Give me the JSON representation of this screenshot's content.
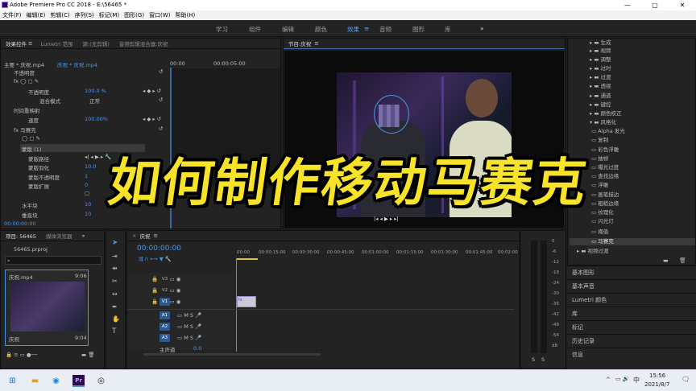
{
  "window": {
    "title": "Adobe Premiere Pro CC 2018 - E:\\56465 *",
    "controls": [
      "—",
      "▢",
      "✕"
    ]
  },
  "menu": [
    "文件(F)",
    "编辑(E)",
    "剪辑(C)",
    "序列(S)",
    "标记(M)",
    "图形(G)",
    "窗口(W)",
    "帮助(H)"
  ],
  "workspaces": {
    "items": [
      "学习",
      "组件",
      "编辑",
      "颜色",
      "效果",
      "音频",
      "图形",
      "库"
    ],
    "active": "效果",
    "menu_glyph": "≡",
    "overflow": "»"
  },
  "effect_controls": {
    "tabs": [
      "效果控件",
      "Lumetri 范围",
      "源:(无剪辑)",
      "音频剪辑混合器:庆祝"
    ],
    "active_tab": "效果控件",
    "tab_menu": "≡",
    "header_left": "主要 * 庆祝.mp4",
    "header_right": "庆祝 * 庆祝.mp4",
    "ruler_start": "00:00",
    "ruler_mid": "00:00:05:00",
    "rows": {
      "opacity_header": "不透明度",
      "opacity": "不透明度",
      "opacity_value": "100.0 %",
      "blend_mode": "混合模式",
      "blend_value": "正常",
      "time_remap": "时间重映射",
      "speed": "速度",
      "speed_value": "100.00%",
      "mosaic": "马赛克",
      "mask": "蒙版 (1)",
      "mask_path": "蒙版路径",
      "mask_feather": "蒙版羽化",
      "mask_feather_value": "10.0",
      "mask_opacity": "蒙版不透明度",
      "mask_opacity_value": "1",
      "mask_expand": "蒙版扩展",
      "mask_expand_value": "0",
      "h_blocks": "水平块",
      "h_blocks_value": "10",
      "v_blocks": "垂直块",
      "v_blocks_value": "10"
    },
    "timecode": "00:00:00:00"
  },
  "program_monitor": {
    "title": "节目:庆祝",
    "menu_glyph": "≡"
  },
  "overlay": {
    "headline": "如何制作移动马赛克"
  },
  "effects_tree": {
    "items": [
      {
        "label": "生成",
        "kind": "folder"
      },
      {
        "label": "视频",
        "kind": "folder"
      },
      {
        "label": "调整",
        "kind": "folder"
      },
      {
        "label": "过时",
        "kind": "folder"
      },
      {
        "label": "过渡",
        "kind": "folder"
      },
      {
        "label": "透视",
        "kind": "folder"
      },
      {
        "label": "通道",
        "kind": "folder"
      },
      {
        "label": "键控",
        "kind": "folder"
      },
      {
        "label": "颜色校正",
        "kind": "folder"
      },
      {
        "label": "风格化",
        "kind": "folder-open"
      },
      {
        "label": "Alpha 发光",
        "kind": "effect"
      },
      {
        "label": "复制",
        "kind": "effect"
      },
      {
        "label": "彩色浮雕",
        "kind": "effect"
      },
      {
        "label": "抽帧",
        "kind": "effect"
      },
      {
        "label": "曝光过度",
        "kind": "effect"
      },
      {
        "label": "查找边缘",
        "kind": "effect"
      },
      {
        "label": "浮雕",
        "kind": "effect"
      },
      {
        "label": "画笔描边",
        "kind": "effect"
      },
      {
        "label": "粗糙边缘",
        "kind": "effect"
      },
      {
        "label": "纹理化",
        "kind": "effect"
      },
      {
        "label": "闪光灯",
        "kind": "effect"
      },
      {
        "label": "阈值",
        "kind": "effect"
      },
      {
        "label": "马赛克",
        "kind": "effect-selected"
      },
      {
        "label": "视频过渡",
        "kind": "folder"
      }
    ]
  },
  "side_panels": [
    "基本图形",
    "基本声音",
    "Lumetri 颜色",
    "库",
    "标记",
    "历史记录",
    "信息"
  ],
  "project": {
    "tabs": [
      "项目: 56465",
      "媒体浏览器"
    ],
    "overflow": "»",
    "file": "56465.prproj",
    "search_glyph": "⌕",
    "clip_name": "庆祝.mp4",
    "clip_duration": "9:06",
    "clip_label": "庆祝",
    "clip_label_duration": "9:04"
  },
  "timeline": {
    "title": "庆祝",
    "menu_glyph": "≡",
    "close_glyph": "×",
    "timecode": "00:00:00:00",
    "ruler": [
      "00:00",
      "00:00:15:00",
      "00:00:30:00",
      "00:00:45:00",
      "00:01:00:00",
      "00:01:15:00",
      "00:01:30:00",
      "00:01:45:00",
      "00:02:00"
    ],
    "video_tracks": [
      "V3",
      "V2",
      "V1"
    ],
    "audio_tracks": [
      "A1",
      "A2",
      "A3"
    ],
    "master": "主声道",
    "master_value": "0.0",
    "clip_label": "fx",
    "mute": "M",
    "solo": "S"
  },
  "audio_meter": {
    "scale": [
      "0",
      "-6",
      "-12",
      "-18",
      "-24",
      "-30",
      "-36",
      "-42",
      "-48",
      "-54",
      "dB"
    ],
    "solo": "S"
  },
  "taskbar": {
    "time": "15:56",
    "date": "2021/8/7",
    "ime": "中",
    "tray": "^",
    "premiere": "Pr",
    "notify": "🗨"
  },
  "colors": {
    "accent_blue": "#4c95e6",
    "headline_yellow": "#f7e32a",
    "panel_bg": "#232323"
  }
}
